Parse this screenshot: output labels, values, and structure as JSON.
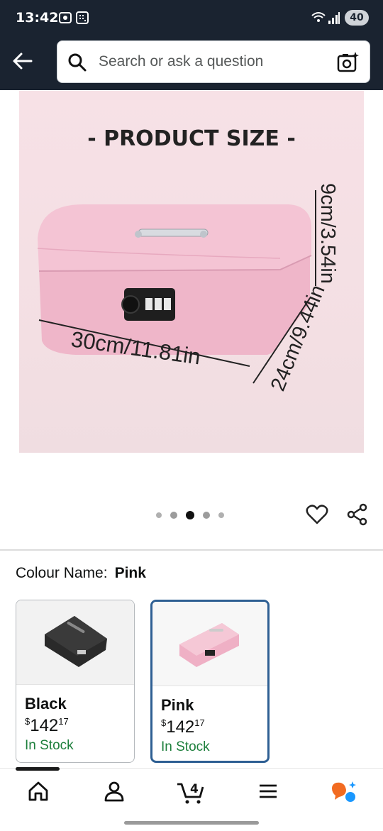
{
  "status": {
    "time": "13:42",
    "battery": "40"
  },
  "search": {
    "placeholder": "Search or ask a question"
  },
  "image": {
    "title": "- PRODUCT SIZE -",
    "dimensions": {
      "width": "30cm/11.81in",
      "depth": "24cm/9.44in",
      "height": "9cm/3.54in"
    },
    "carousel": {
      "count": 5,
      "active_index": 2
    }
  },
  "variant": {
    "label": "Colour Name:",
    "selected": "Pink",
    "options": [
      {
        "name": "Black",
        "currency": "$",
        "price_whole": "142",
        "price_fraction": "17",
        "stock": "In Stock",
        "selected": false
      },
      {
        "name": "Pink",
        "currency": "$",
        "price_whole": "142",
        "price_fraction": "17",
        "stock": "In Stock",
        "selected": true
      }
    ]
  },
  "nav": {
    "cart_count": "4",
    "items": [
      "home-icon",
      "account-icon",
      "cart-icon",
      "menu-icon",
      "rufus-icon"
    ]
  },
  "colors": {
    "header": "#1a2330",
    "accent_blue": "#2e5f93",
    "in_stock_green": "#1d7f3c",
    "rufus_orange": "#f26b21",
    "rufus_blue": "#1a98ff"
  }
}
